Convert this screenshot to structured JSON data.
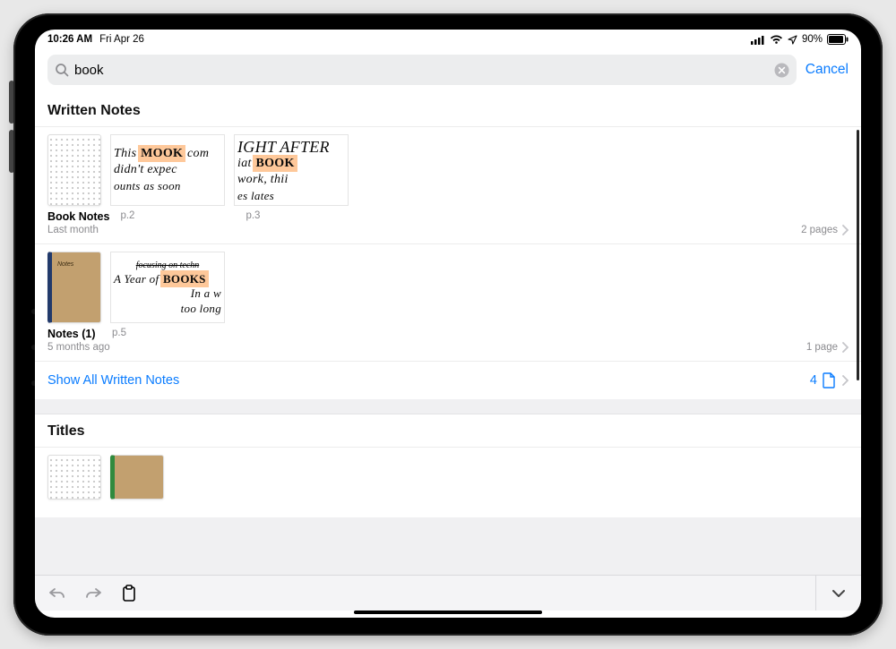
{
  "status": {
    "time": "10:26 AM",
    "date": "Fri Apr 26",
    "battery": "90%"
  },
  "search": {
    "value": "book",
    "cancel": "Cancel"
  },
  "sections": {
    "written": {
      "header": "Written Notes",
      "results": [
        {
          "title": "Book Notes",
          "time": "Last month",
          "page_count": "2 pages",
          "previews": [
            {
              "page_label": "p.2",
              "lines": {
                "l1a": "This ",
                "hl": "MOOK",
                "l1b": " com",
                "l2": "didn't expec",
                "l3": "ounts as soon"
              }
            },
            {
              "page_label": "p.3",
              "lines": {
                "l1": "ight after",
                "l2a": "iat ",
                "hl": "BOOK",
                "l3": "work, thii",
                "l4": "es lates"
              }
            }
          ]
        },
        {
          "title": "Notes (1)",
          "time": "5 months ago",
          "page_count": "1 page",
          "previews": [
            {
              "page_label": "p.5",
              "top": "focusing on techn",
              "lines": {
                "l1a": "A Year of ",
                "hl": "Books",
                "l2": "In a w",
                "l3": "too long"
              }
            }
          ]
        }
      ],
      "show_all": {
        "label": "Show All Written Notes",
        "count": "4"
      }
    },
    "titles": {
      "header": "Titles"
    }
  }
}
